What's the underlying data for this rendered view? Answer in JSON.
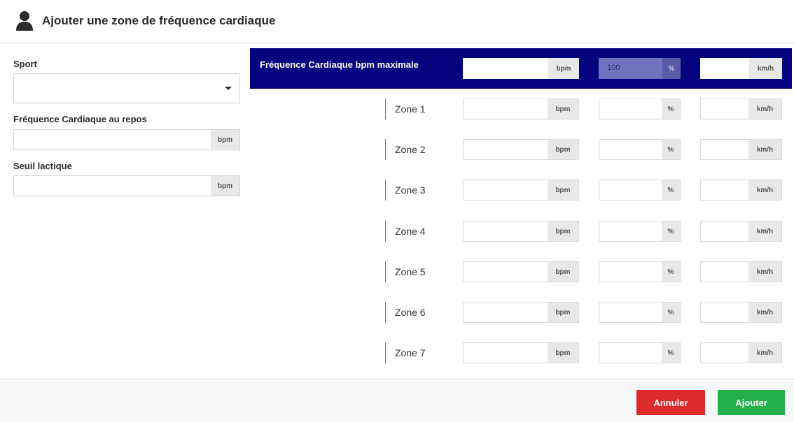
{
  "header": {
    "title": "Ajouter une zone de fréquence cardiaque"
  },
  "left": {
    "sport_label": "Sport",
    "sport_value": "",
    "rest_label": "Fréquence Cardiaque au repos",
    "rest_value": "",
    "rest_unit": "bpm",
    "lactate_label": "Seuil lactique",
    "lactate_value": "",
    "lactate_unit": "bpm"
  },
  "max_row": {
    "label": "Fréquence Cardiaque bpm maximale",
    "bpm_value": "",
    "bpm_unit": "bpm",
    "pct_value": "100",
    "pct_unit": "%",
    "kmh_value": "",
    "kmh_unit": "km/h"
  },
  "zones": [
    {
      "label": "Zone 1",
      "bpm": "",
      "bpm_unit": "bpm",
      "pct": "",
      "pct_unit": "%",
      "kmh": "",
      "kmh_unit": "km/h"
    },
    {
      "label": "Zone 2",
      "bpm": "",
      "bpm_unit": "bpm",
      "pct": "",
      "pct_unit": "%",
      "kmh": "",
      "kmh_unit": "km/h"
    },
    {
      "label": "Zone 3",
      "bpm": "",
      "bpm_unit": "bpm",
      "pct": "",
      "pct_unit": "%",
      "kmh": "",
      "kmh_unit": "km/h"
    },
    {
      "label": "Zone 4",
      "bpm": "",
      "bpm_unit": "bpm",
      "pct": "",
      "pct_unit": "%",
      "kmh": "",
      "kmh_unit": "km/h"
    },
    {
      "label": "Zone 5",
      "bpm": "",
      "bpm_unit": "bpm",
      "pct": "",
      "pct_unit": "%",
      "kmh": "",
      "kmh_unit": "km/h"
    },
    {
      "label": "Zone 6",
      "bpm": "",
      "bpm_unit": "bpm",
      "pct": "",
      "pct_unit": "%",
      "kmh": "",
      "kmh_unit": "km/h"
    },
    {
      "label": "Zone 7",
      "bpm": "",
      "bpm_unit": "bpm",
      "pct": "",
      "pct_unit": "%",
      "kmh": "",
      "kmh_unit": "km/h"
    }
  ],
  "footer": {
    "cancel_label": "Annuler",
    "add_label": "Ajouter"
  },
  "colors": {
    "header_row": "#03037f",
    "cancel": "#dd2a2a",
    "add": "#23b04b"
  },
  "icons": {
    "header": "user-icon",
    "select": "caret-down-icon"
  }
}
